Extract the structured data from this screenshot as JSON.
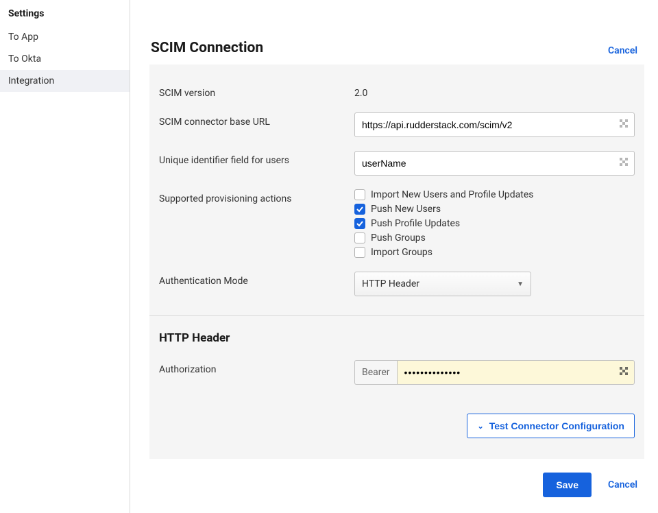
{
  "sidebar": {
    "title": "Settings",
    "items": [
      {
        "label": "To App",
        "active": false
      },
      {
        "label": "To Okta",
        "active": false
      },
      {
        "label": "Integration",
        "active": true
      }
    ]
  },
  "main": {
    "title": "SCIM Connection",
    "cancel": "Cancel",
    "scim_version_label": "SCIM version",
    "scim_version_value": "2.0",
    "base_url_label": "SCIM connector base URL",
    "base_url_value": "https://api.rudderstack.com/scim/v2",
    "unique_id_label": "Unique identifier field for users",
    "unique_id_value": "userName",
    "provisioning_label": "Supported provisioning actions",
    "provisioning_options": [
      {
        "label": "Import New Users and Profile Updates",
        "checked": false
      },
      {
        "label": "Push New Users",
        "checked": true
      },
      {
        "label": "Push Profile Updates",
        "checked": true
      },
      {
        "label": "Push Groups",
        "checked": false
      },
      {
        "label": "Import Groups",
        "checked": false
      }
    ],
    "auth_mode_label": "Authentication Mode",
    "auth_mode_value": "HTTP Header",
    "http_header_title": "HTTP Header",
    "authorization_label": "Authorization",
    "authorization_prefix": "Bearer",
    "authorization_mask": "••••••••••••••",
    "test_button": "Test Connector Configuration",
    "save_button": "Save",
    "footer_cancel": "Cancel"
  }
}
